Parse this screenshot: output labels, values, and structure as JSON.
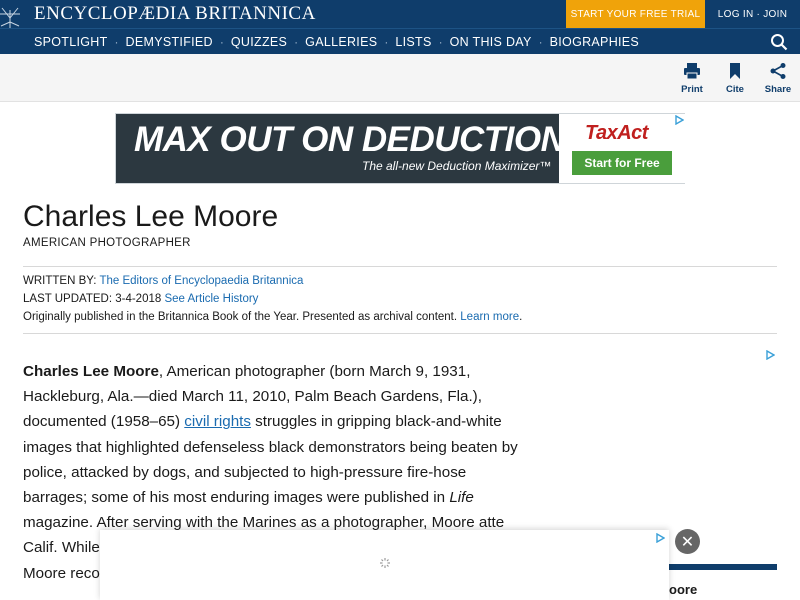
{
  "header": {
    "brand": "ENCYCLOPÆDIA BRITANNICA",
    "trial_button": "START YOUR FREE TRIAL",
    "login": "LOG IN · JOIN"
  },
  "nav": {
    "items": [
      "SPOTLIGHT",
      "DEMYSTIFIED",
      "QUIZZES",
      "GALLERIES",
      "LISTS",
      "ON THIS DAY",
      "BIOGRAPHIES"
    ]
  },
  "toolbar": {
    "print": "Print",
    "cite": "Cite",
    "share": "Share"
  },
  "ad": {
    "headline": "MAX OUT ON DEDUCTIONS.",
    "sub": "The all-new Deduction Maximizer™",
    "brand": "TaxAct",
    "cta": "Start for Free"
  },
  "article": {
    "title": "Charles Lee Moore",
    "subtitle": "AMERICAN PHOTOGRAPHER",
    "written_by_label": "WRITTEN BY:",
    "written_by": "The Editors of Encyclopaedia Britannica",
    "updated_label": "LAST UPDATED: 3-4-2018",
    "history_link": "See Article History",
    "archival_note": "Originally published in the Britannica Book of the Year. Presented as archival content.",
    "learn_more": "Learn more",
    "lead_name": "Charles Lee Moore",
    "p1": ", American photographer (born March 9, 1931, Hackleburg, Ala.—died March 11, 2010, Palm Beach Gardens, Fla.), documented (1958–65) ",
    "civil_rights": "civil rights",
    "p2": " struggles in gripping black-and-white images that highlighted defenseless black demonstrators being beaten by police, attacked by dogs, and subjected to high-pressure fire-hose barrages; some of his most enduring images were published in ",
    "life": "Life",
    "p3": " magazine. After serving with the Marines as a photographer, Moore atte",
    "line_calif": "Calif. While",
    "line_moore": "Moore reco"
  },
  "sidebar": {
    "partial_text": "oore"
  }
}
